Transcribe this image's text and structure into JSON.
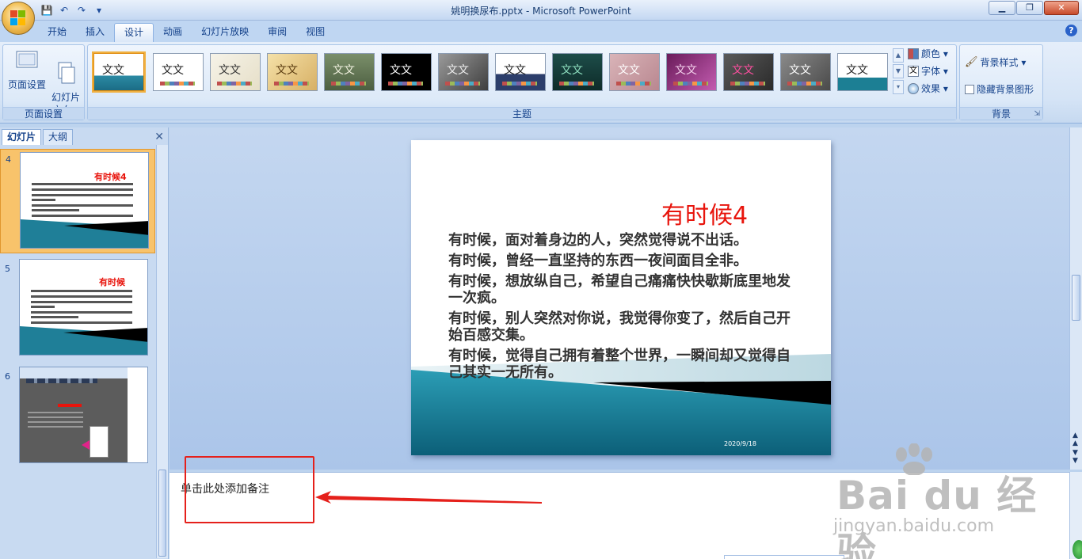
{
  "window": {
    "title": "姚明换尿布.pptx - Microsoft PowerPoint",
    "minimize": "▁",
    "maximize": "❐",
    "close": "✕"
  },
  "qat": {
    "save": "💾",
    "undo": "↶",
    "redo": "↷",
    "more": "▾"
  },
  "tabs": [
    {
      "label": "开始"
    },
    {
      "label": "插入"
    },
    {
      "label": "设计",
      "active": true
    },
    {
      "label": "动画"
    },
    {
      "label": "幻灯片放映"
    },
    {
      "label": "审阅"
    },
    {
      "label": "视图"
    }
  ],
  "help": "?",
  "ribbon": {
    "page_setup": {
      "group_label": "页面设置",
      "page_setup_label": "页面设置",
      "orientation_label": "幻灯片\n方向 ▾"
    },
    "themes": {
      "group_label": "主题",
      "tile_text": "文文",
      "tile_text_alt": "文文"
    },
    "theme_options": {
      "colors": "颜色 ▾",
      "fonts": "字体 ▾",
      "effects": "效果 ▾"
    },
    "background": {
      "group_label": "背景",
      "styles": "背景样式 ▾",
      "hide_graphics": "隐藏背景图形"
    }
  },
  "left_panel": {
    "tab_slides": "幻灯片",
    "tab_outline": "大纲",
    "close": "✕",
    "thumbs": [
      {
        "num": "4",
        "title": "有时候4"
      },
      {
        "num": "5",
        "title": "有时候"
      },
      {
        "num": "6",
        "title": ""
      }
    ]
  },
  "slide": {
    "title": "有时候4",
    "lines": [
      "有时候，面对着身边的人，突然觉得说不出话。",
      "有时候，曾经一直坚持的东西一夜间面目全非。",
      "有时候，想放纵自己，希望自己痛痛快快歇斯底里地发一次疯。",
      "有时候，别人突然对你说，我觉得你变了，然后自己开始百感交集。",
      "有时候，觉得自己拥有着整个世界，一瞬间却又觉得自己其实一无所有。"
    ],
    "date": "2020/9/18"
  },
  "notes": {
    "placeholder": "单击此处添加备注"
  },
  "watermark": {
    "brand": "Bai du 经验",
    "url": "jingyan.baidu.com"
  },
  "colors": {
    "slide_title": "#e8140c",
    "annotation": "#e5201b",
    "ribbon_text": "#15428b"
  }
}
